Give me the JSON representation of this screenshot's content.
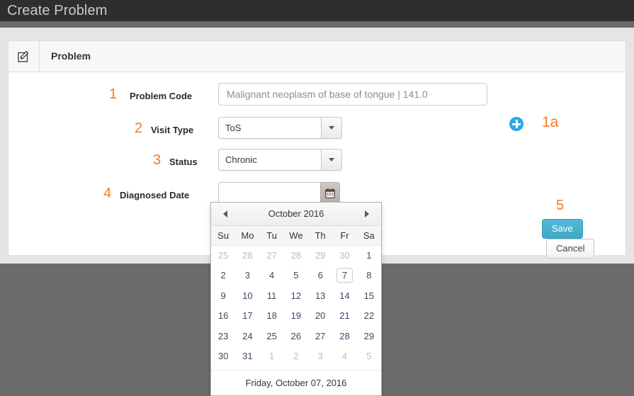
{
  "window": {
    "title": "Create Problem"
  },
  "panel": {
    "icon": "edit-square-icon",
    "title": "Problem"
  },
  "form": {
    "fields": [
      {
        "number": "1",
        "label": "Problem Code",
        "type": "text",
        "value": "Malignant neoplasm of base of tongue | 141.0",
        "placeholder": "Malignant neoplasm of base of tongue | 141.0"
      },
      {
        "number": "2",
        "label": "Visit Type",
        "type": "select",
        "value": "ToS"
      },
      {
        "number": "3",
        "label": "Status",
        "type": "select",
        "value": "Chronic"
      },
      {
        "number": "4",
        "label": "Diagnosed Date",
        "type": "date",
        "value": "",
        "placeholder": ""
      }
    ],
    "add_annotation": "1a",
    "add_icon": "plus-circle-icon",
    "actions_annotation": "5"
  },
  "buttons": {
    "save": "Save",
    "cancel": "Cancel"
  },
  "datepicker": {
    "prev_icon": "triangle-left-icon",
    "next_icon": "triangle-right-icon",
    "month_title": "October 2016",
    "weekdays": [
      "Su",
      "Mo",
      "Tu",
      "We",
      "Th",
      "Fr",
      "Sa"
    ],
    "weeks": [
      [
        {
          "d": "25",
          "mute": true
        },
        {
          "d": "26",
          "mute": true
        },
        {
          "d": "27",
          "mute": true
        },
        {
          "d": "28",
          "mute": true
        },
        {
          "d": "29",
          "mute": true
        },
        {
          "d": "30",
          "mute": true
        },
        {
          "d": "1",
          "mute": false
        }
      ],
      [
        {
          "d": "2",
          "mute": false
        },
        {
          "d": "3",
          "mute": false
        },
        {
          "d": "4",
          "mute": false
        },
        {
          "d": "5",
          "mute": false
        },
        {
          "d": "6",
          "mute": false
        },
        {
          "d": "7",
          "mute": false,
          "today": true
        },
        {
          "d": "8",
          "mute": false
        }
      ],
      [
        {
          "d": "9",
          "mute": false
        },
        {
          "d": "10",
          "mute": false
        },
        {
          "d": "11",
          "mute": false
        },
        {
          "d": "12",
          "mute": false
        },
        {
          "d": "13",
          "mute": false
        },
        {
          "d": "14",
          "mute": false
        },
        {
          "d": "15",
          "mute": false
        }
      ],
      [
        {
          "d": "16",
          "mute": false
        },
        {
          "d": "17",
          "mute": false
        },
        {
          "d": "18",
          "mute": false
        },
        {
          "d": "19",
          "mute": false
        },
        {
          "d": "20",
          "mute": false
        },
        {
          "d": "21",
          "mute": false
        },
        {
          "d": "22",
          "mute": false
        }
      ],
      [
        {
          "d": "23",
          "mute": false
        },
        {
          "d": "24",
          "mute": false
        },
        {
          "d": "25",
          "mute": false
        },
        {
          "d": "26",
          "mute": false
        },
        {
          "d": "27",
          "mute": false
        },
        {
          "d": "28",
          "mute": false
        },
        {
          "d": "29",
          "mute": false
        }
      ],
      [
        {
          "d": "30",
          "mute": false
        },
        {
          "d": "31",
          "mute": false
        },
        {
          "d": "1",
          "mute": true
        },
        {
          "d": "2",
          "mute": true
        },
        {
          "d": "3",
          "mute": true
        },
        {
          "d": "4",
          "mute": true
        },
        {
          "d": "5",
          "mute": true
        }
      ]
    ],
    "footer": "Friday, October 07, 2016"
  },
  "colors": {
    "titlebar": "#2e2e2e",
    "annotation_orange": "#f47b20",
    "accent_blue": "#29abe2",
    "save_button": "#3fa9c9",
    "page_background": "#6b6b6b"
  }
}
